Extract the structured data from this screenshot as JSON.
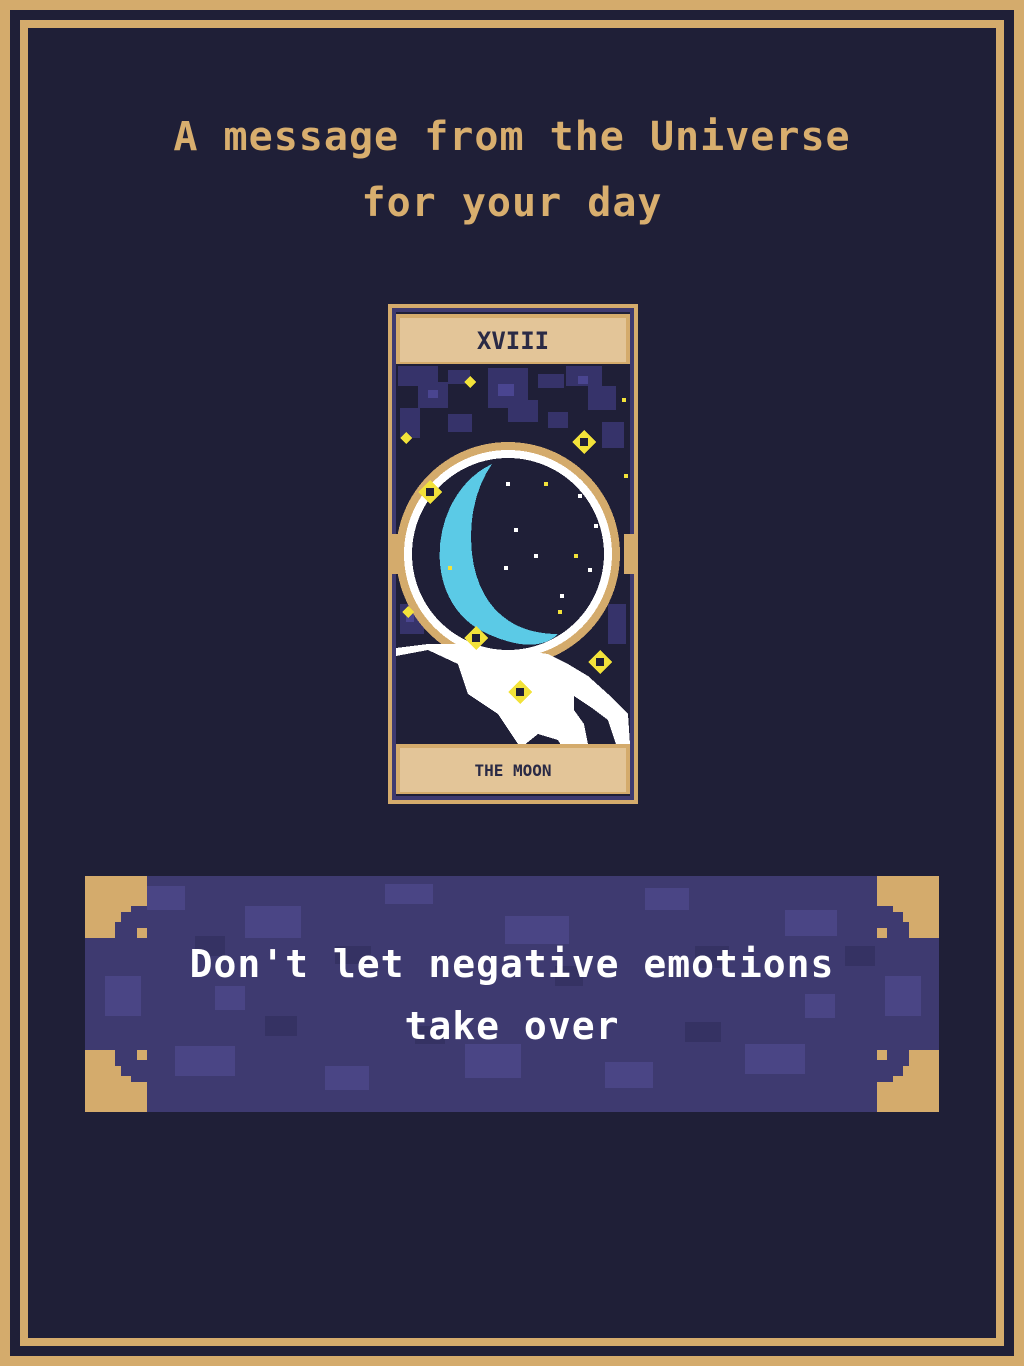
{
  "heading": {
    "line1": "A message from the Universe",
    "line2": "for your day"
  },
  "card": {
    "numeral": "XVIII",
    "name": "THE MOON"
  },
  "message": {
    "line1": "Don't let negative emotions",
    "line2": "take over"
  },
  "colors": {
    "background": "#1f1f37",
    "gold": "#d4ab6c",
    "banner": "#3e3a70",
    "moon": "#5bcae6",
    "star": "#f2e23a"
  }
}
